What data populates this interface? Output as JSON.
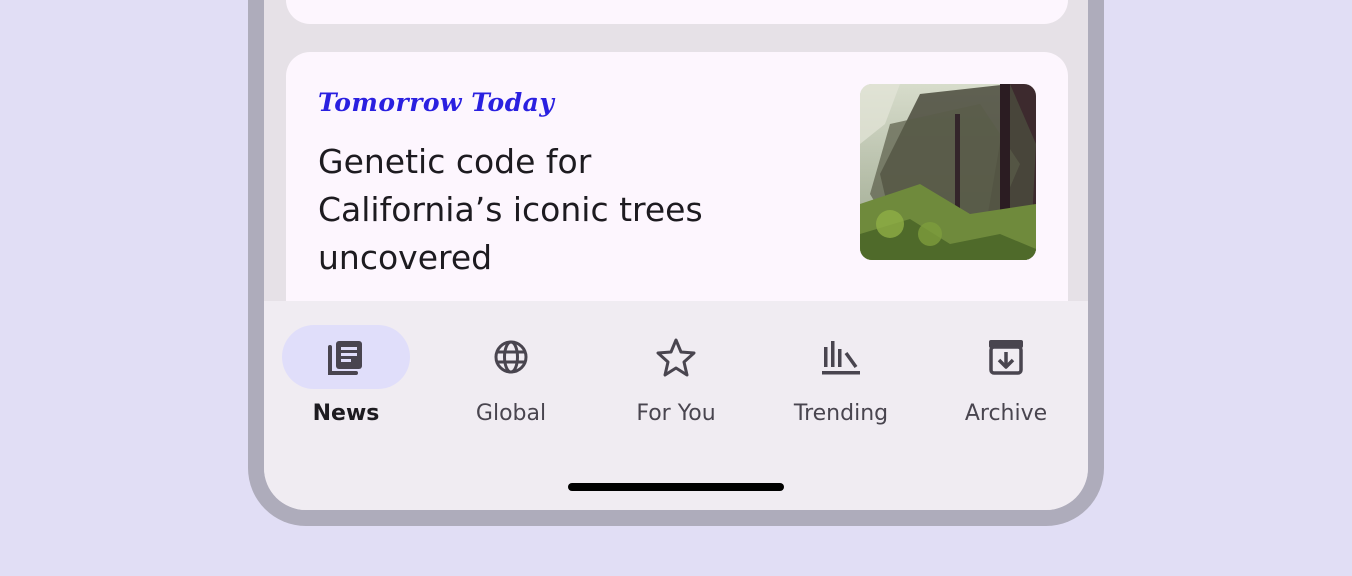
{
  "article": {
    "source": "Tomorrow Today",
    "headline": "Genetic code for California’s iconic trees uncovered",
    "thumbnail_icon": "forest-trees-photo"
  },
  "nav": {
    "items": [
      {
        "label": "News",
        "icon": "newspaper-icon",
        "active": true
      },
      {
        "label": "Global",
        "icon": "globe-icon",
        "active": false
      },
      {
        "label": "For You",
        "icon": "star-icon",
        "active": false
      },
      {
        "label": "Trending",
        "icon": "trending-chart-icon",
        "active": false
      },
      {
        "label": "Archive",
        "icon": "archive-icon",
        "active": false
      }
    ]
  },
  "colors": {
    "page_background": "#e1def5",
    "device_frame": "#aeacbb",
    "card": "#fdf6fe",
    "source_accent": "#2a20e0",
    "nav_background": "#f0ecf2",
    "active_pill": "#e0defa"
  }
}
